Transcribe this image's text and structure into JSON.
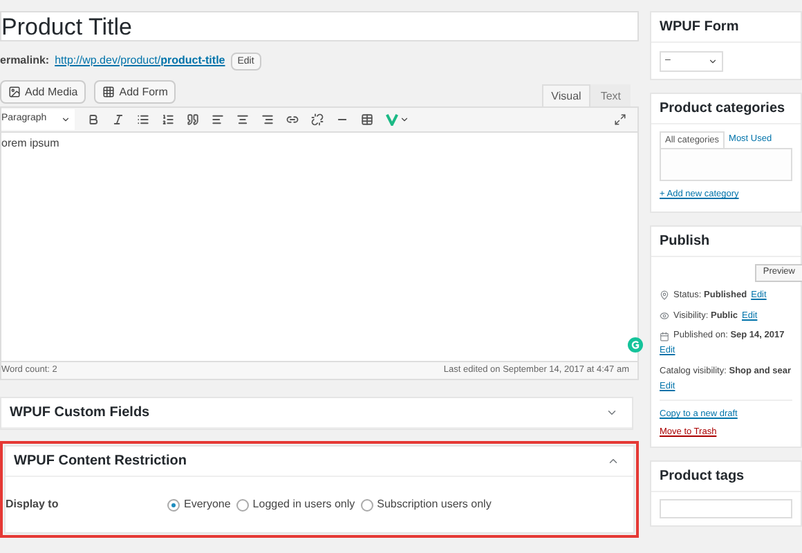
{
  "title_field": {
    "value": "Product Title"
  },
  "permalink": {
    "label": "ermalink:",
    "url_base": "http://wp.dev/product/",
    "slug": "product-title",
    "button": "Edit"
  },
  "media_buttons": [
    {
      "kind": "media",
      "label": "Add Media"
    },
    {
      "kind": "form",
      "label": "Add Form"
    }
  ],
  "editor_tabs": [
    {
      "label": "Visual",
      "selected": true
    },
    {
      "label": "Text",
      "selected": false
    }
  ],
  "toolbar": {
    "format": "Paragraph"
  },
  "editor": {
    "content": "orem ipsum",
    "word_count": "Word count: 2",
    "last_edited": "Last edited on September 14, 2017 at 4:47 am"
  },
  "custom_fields_box": {
    "title": "WPUF Custom Fields",
    "expanded": false
  },
  "restriction_box": {
    "title": "WPUF Content Restriction",
    "expanded": true,
    "label": "Display to",
    "options": [
      {
        "label": "Everyone",
        "selected": true
      },
      {
        "label": "Logged in users only",
        "selected": false
      },
      {
        "label": "Subscription users only",
        "selected": false
      }
    ]
  },
  "sidebar": {
    "wpuf_form": {
      "title": "WPUF Form",
      "select_value": "–"
    },
    "categories": {
      "title": "Product categories",
      "tabs": [
        {
          "label": "All categories",
          "selected": true
        },
        {
          "label": "Most Used",
          "selected": false
        }
      ],
      "add_link": "+ Add new category"
    },
    "publish": {
      "title": "Publish",
      "preview_button": "Preview",
      "rows": [
        {
          "kind": "status",
          "label": "Status:",
          "value": "Published",
          "link": "Edit"
        },
        {
          "kind": "visibility",
          "label": "Visibility:",
          "value": "Public",
          "link": "Edit"
        },
        {
          "kind": "date",
          "label": "Published on:",
          "value": "Sep 14, 2017",
          "link": "Edit"
        },
        {
          "kind": "catalog",
          "label": "Catalog visibility:",
          "value": "Shop and sear",
          "link": "Edit"
        }
      ],
      "copy_link": "Copy to a new draft",
      "trash_link": "Move to Trash"
    },
    "tags": {
      "title": "Product tags"
    }
  }
}
